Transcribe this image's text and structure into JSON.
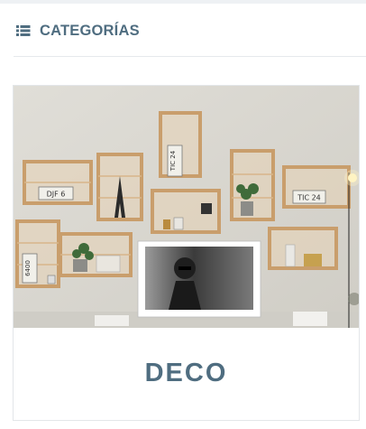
{
  "widget": {
    "title": "CATEGORÍAS",
    "icon": "list-icon"
  },
  "category_card": {
    "title": "DECO",
    "image_icon": "category-photo",
    "plate_texts": [
      "DJF 6",
      "TIC 24",
      "TIC 24",
      "6400"
    ]
  },
  "colors": {
    "accent": "#4f6d80",
    "border": "#e3e6e9",
    "wall": "#d9d6ce",
    "wood": "#d8b58a"
  }
}
